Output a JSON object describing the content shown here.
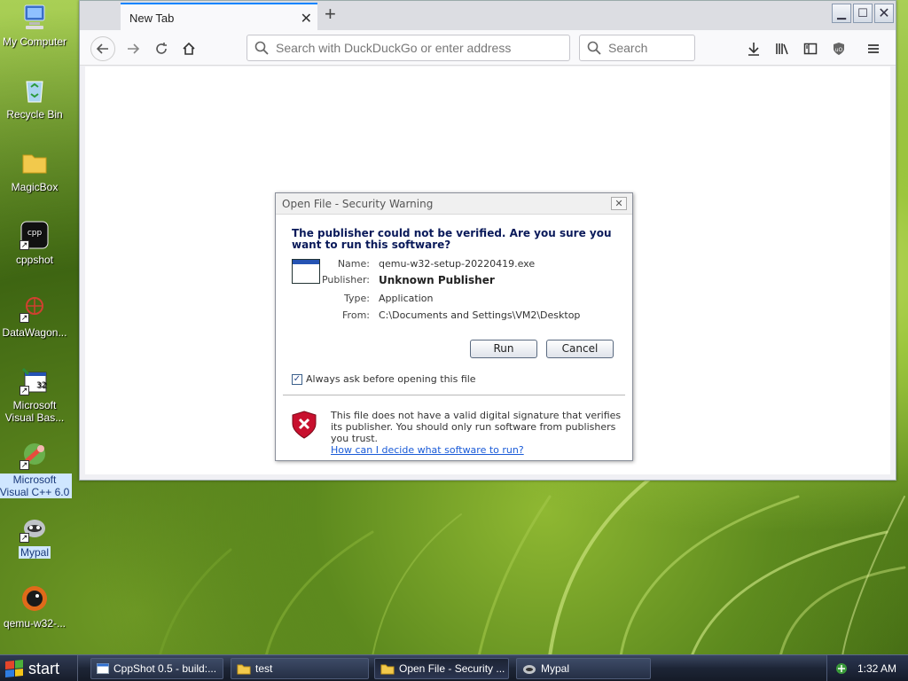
{
  "desktop": {
    "icons": [
      {
        "label": "My Computer"
      },
      {
        "label": "Recycle Bin"
      },
      {
        "label": "MagicBox"
      },
      {
        "label": "cppshot"
      },
      {
        "label": "DataWagon..."
      },
      {
        "label": "Microsoft Visual Bas..."
      },
      {
        "label": "Microsoft Visual C++ 6.0"
      },
      {
        "label": "Mypal"
      },
      {
        "label": "qemu-w32-..."
      }
    ]
  },
  "browser": {
    "tab_title": "New Tab",
    "address_placeholder": "Search with DuckDuckGo or enter address",
    "search_placeholder": "Search"
  },
  "dialog": {
    "title": "Open File - Security Warning",
    "close": "✕",
    "heading": "The publisher could not be verified.  Are you sure you want to run this software?",
    "fields": {
      "name_key": "Name:",
      "name_val": "qemu-w32-setup-20220419.exe",
      "publisher_key": "Publisher:",
      "publisher_val": "Unknown Publisher",
      "type_key": "Type:",
      "type_val": "Application",
      "from_key": "From:",
      "from_val": "C:\\Documents and Settings\\VM2\\Desktop"
    },
    "run_label": "Run",
    "cancel_label": "Cancel",
    "checkbox_label": "Always ask before opening this file",
    "checkbox_checked": true,
    "warning_text": "This file does not have a valid digital signature that verifies its publisher.  You should only run software from publishers you trust.",
    "warning_link": "How can I decide what software to run?"
  },
  "taskbar": {
    "start_label": "start",
    "tasks": [
      {
        "label": "CppShot 0.5 - build:..."
      },
      {
        "label": "test"
      },
      {
        "label": "Open File - Security ..."
      },
      {
        "label": "Mypal"
      }
    ],
    "clock": "1:32 AM"
  },
  "colors": {
    "accent": "#0a84ff",
    "dialog_heading": "#0a1a5a",
    "link": "#1a5bd8",
    "shield_red": "#c8102e"
  }
}
